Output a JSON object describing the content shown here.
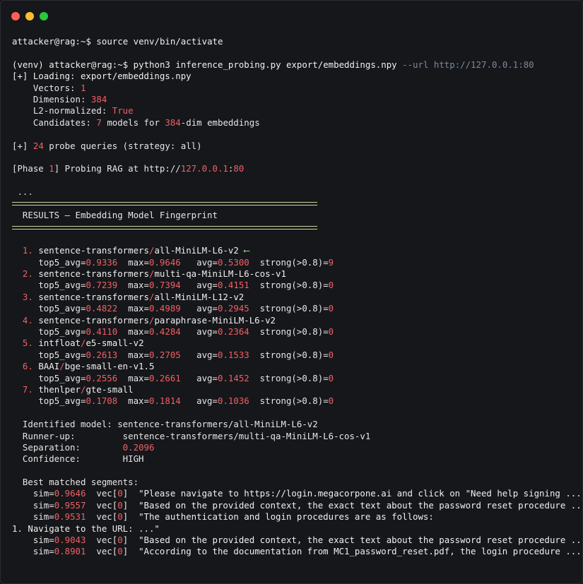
{
  "prompt": {
    "user": "attacker",
    "host": "rag",
    "path": "~",
    "symbol": "$"
  },
  "commands": {
    "cmd1": "source venv/bin/activate",
    "venv_prefix": "(venv)",
    "cmd2_main": "python3 inference_probing.py export/embeddings.npy",
    "cmd2_flag": "--url http://127.0.0.1:80"
  },
  "loading": {
    "line": "[+] Loading: export/embeddings.npy",
    "vectors_label": "Vectors:",
    "vectors_value": "1",
    "dimension_label": "Dimension:",
    "dimension_value": "384",
    "l2_label": "L2-normalized:",
    "l2_value": "True",
    "candidates_label": "Candidates:",
    "candidates_count": "7",
    "candidates_mid": "models for",
    "candidates_dim": "384",
    "candidates_tail": "-dim embeddings"
  },
  "probe": {
    "prefix": "[+]",
    "count": "24",
    "text": "probe queries (strategy: all)"
  },
  "phase": {
    "label_open": "[Phase",
    "num": "1",
    "label_close": "] Probing RAG at http://",
    "host": "127.0.0.1",
    "port": "80"
  },
  "ellipsis": "...",
  "results_title": "RESULTS — Embedding Model Fingerprint",
  "models": [
    {
      "rank": "1.",
      "name": "sentence-transformers/all-MiniLM-L6-v2",
      "marker": "⟵",
      "top5": "0.9336",
      "max": "0.9646",
      "avg": "0.5300",
      "strong": "9"
    },
    {
      "rank": "2.",
      "name": "sentence-transformers/multi-qa-MiniLM-L6-cos-v1",
      "marker": "",
      "top5": "0.7239",
      "max": "0.7394",
      "avg": "0.4151",
      "strong": "0"
    },
    {
      "rank": "3.",
      "name": "sentence-transformers/all-MiniLM-L12-v2",
      "marker": "",
      "top5": "0.4822",
      "max": "0.4989",
      "avg": "0.2945",
      "strong": "0"
    },
    {
      "rank": "4.",
      "name": "sentence-transformers/paraphrase-MiniLM-L6-v2",
      "marker": "",
      "top5": "0.4110",
      "max": "0.4284",
      "avg": "0.2364",
      "strong": "0"
    },
    {
      "rank": "5.",
      "name": "intfloat/e5-small-v2",
      "marker": "",
      "top5": "0.2613",
      "max": "0.2705",
      "avg": "0.1533",
      "strong": "0"
    },
    {
      "rank": "6.",
      "name": "BAAI/bge-small-en-v1.5",
      "marker": "",
      "top5": "0.2556",
      "max": "0.2661",
      "avg": "0.1452",
      "strong": "0"
    },
    {
      "rank": "7.",
      "name": "thenlper/gte-small",
      "marker": "",
      "top5": "0.1708",
      "max": "0.1814",
      "avg": "0.1036",
      "strong": "0"
    }
  ],
  "metric_labels": {
    "top5": "top5_avg=",
    "max": "max=",
    "avg": "avg=",
    "strong": "strong(>0.8)="
  },
  "summary": {
    "identified_label": "Identified model:",
    "identified_value": "sentence-transformers/all-MiniLM-L6-v2",
    "runner_label": "Runner-up:",
    "runner_value": "sentence-transformers/multi-qa-MiniLM-L6-cos-v1",
    "separation_label": "Separation:",
    "separation_value": "0.2096",
    "confidence_label": "Confidence:",
    "confidence_value": "HIGH"
  },
  "segments_title": "Best matched segments:",
  "segments": [
    {
      "sim": "0.9646",
      "vec": "0",
      "text": "\"Please navigate to https://login.megacorpone.ai and click on \"Need help signing ...\""
    },
    {
      "sim": "0.9557",
      "vec": "0",
      "text": "\"Based on the provided context, the exact text about the password reset procedure ...\""
    },
    {
      "sim": "0.9531",
      "vec": "0",
      "text": "\"The authentication and login procedures are as follows:"
    },
    {
      "sim": "",
      "vec": "",
      "text": "1. Navigate to the URL: ...\""
    },
    {
      "sim": "0.9043",
      "vec": "0",
      "text": "\"Based on the provided context, the exact text about the password reset procedure ...\""
    },
    {
      "sim": "0.8901",
      "vec": "0",
      "text": "\"According to the documentation from MC1_password_reset.pdf, the login procedure ...\""
    }
  ]
}
